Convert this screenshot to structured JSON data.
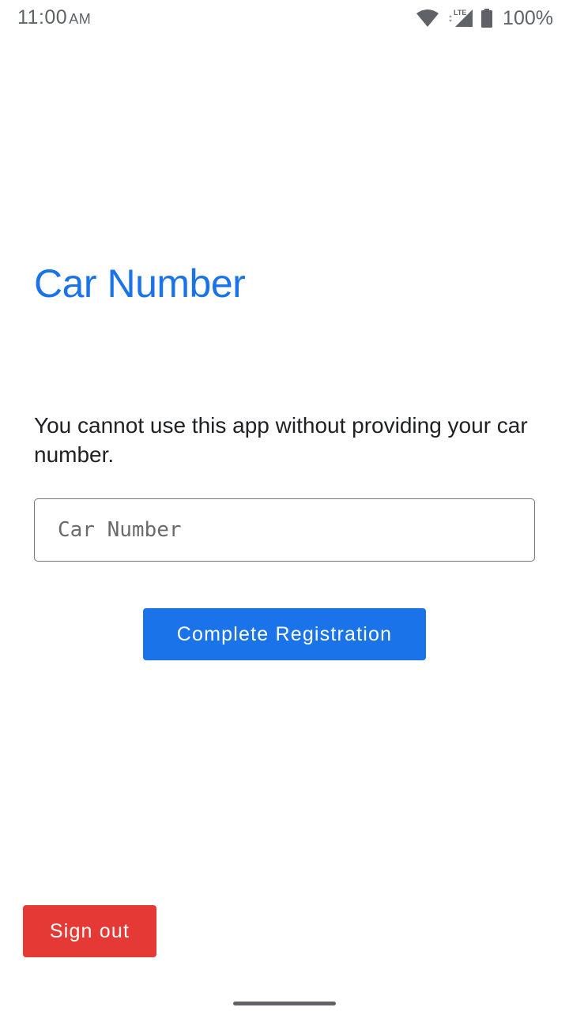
{
  "status_bar": {
    "time": "11:00",
    "ampm": "AM",
    "battery": "100%",
    "icons": [
      "wifi-icon",
      "lte-signal-icon",
      "battery-icon"
    ],
    "network_label": "LTE"
  },
  "main": {
    "title": "Car Number",
    "message": "You cannot use this app without providing your car number.",
    "car_input": {
      "placeholder": "Car Number",
      "value": ""
    },
    "complete_label": "Complete Registration",
    "signout_label": "Sign out"
  },
  "colors": {
    "accent": "#1a73e8",
    "danger": "#e53935",
    "text": "#202124",
    "muted": "#5f6368"
  }
}
